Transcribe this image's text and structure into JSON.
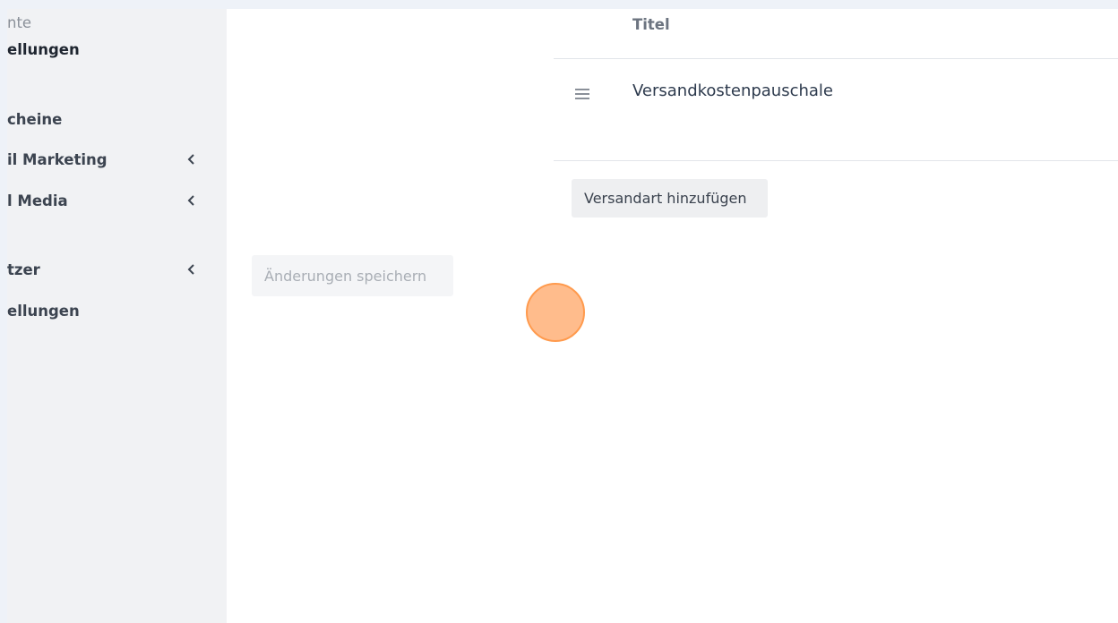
{
  "sidebar": {
    "items": [
      {
        "label": "nte",
        "style": "muted",
        "chevron": false
      },
      {
        "label": "ellungen",
        "style": "dark",
        "chevron": false
      },
      {
        "label": "cheine",
        "style": "normal",
        "chevron": false
      },
      {
        "label": "il Marketing",
        "style": "normal",
        "chevron": true
      },
      {
        "label": "l Media",
        "style": "normal",
        "chevron": true
      },
      {
        "label": "tzer",
        "style": "normal",
        "chevron": true
      },
      {
        "label": "ellungen",
        "style": "normal",
        "chevron": false
      }
    ]
  },
  "shipping_table": {
    "column_title": "Titel",
    "rows": [
      {
        "title": "Versandkostenpauschale"
      }
    ],
    "add_button_label": "Versandart hinzufügen"
  },
  "form": {
    "save_button_label": "Änderungen speichern"
  },
  "colors": {
    "page_bg": "#eef2f8",
    "sidebar_bg": "#f1f2f4",
    "main_bg": "#ffffff",
    "click_indicator": "#ffb078"
  }
}
